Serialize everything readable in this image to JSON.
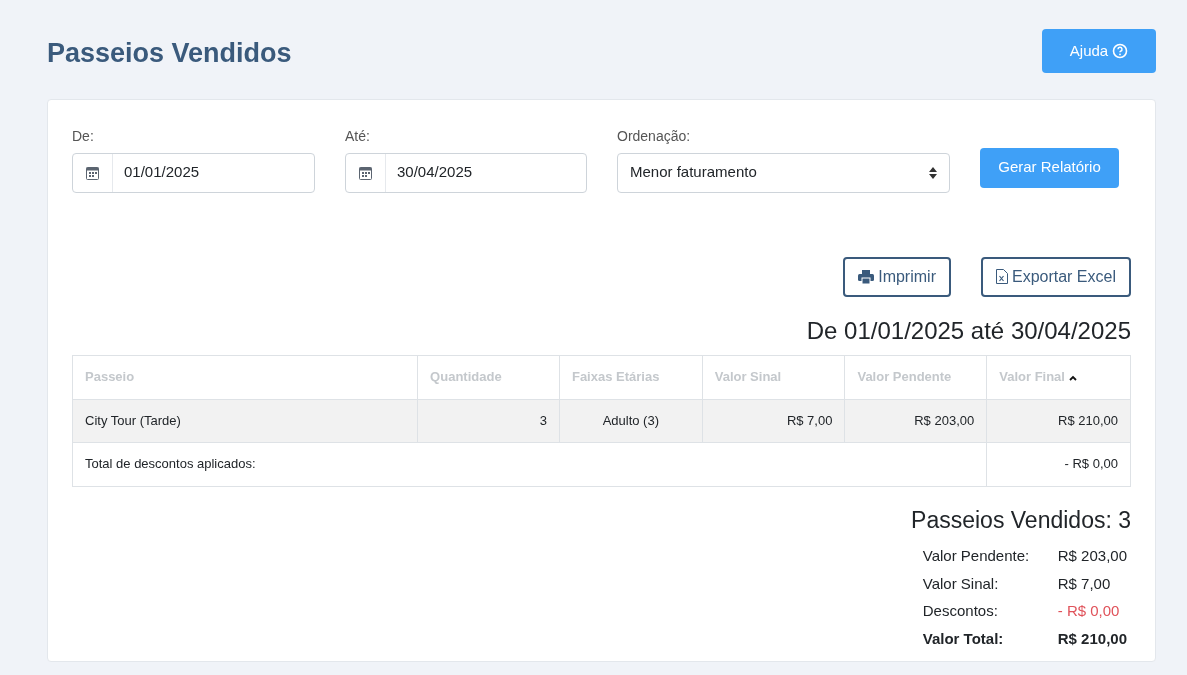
{
  "page": {
    "title": "Passeios Vendidos",
    "help_button": "Ajuda"
  },
  "filters": {
    "from": {
      "label": "De:",
      "value": "01/01/2025"
    },
    "to": {
      "label": "Até:",
      "value": "30/04/2025"
    },
    "sort": {
      "label": "Ordenação:",
      "value": "Menor faturamento"
    },
    "submit": "Gerar Relatório"
  },
  "actions": [
    {
      "kind": "print",
      "label": "Imprimir"
    },
    {
      "kind": "excel",
      "label": "Exportar Excel"
    }
  ],
  "report": {
    "period": "De 01/01/2025 até 30/04/2025",
    "table": {
      "columns": [
        {
          "label": "Passeio",
          "sorted": false
        },
        {
          "label": "Quantidade",
          "sorted": false
        },
        {
          "label": "Faixas Etárias",
          "sorted": false
        },
        {
          "label": "Valor Sinal",
          "sorted": false
        },
        {
          "label": "Valor Pendente",
          "sorted": false
        },
        {
          "label": "Valor Final",
          "sorted": true
        }
      ],
      "rows": [
        [
          "City Tour (Tarde)",
          "3",
          "Adulto (3)",
          "R$ 7,00",
          "R$ 203,00",
          "R$ 210,00"
        ]
      ],
      "discount_row": {
        "label": "Total de descontos aplicados:",
        "value": "- R$ 0,00"
      }
    },
    "summary_title": "Passeios Vendidos: 3",
    "summary": [
      {
        "kind": "normal",
        "label": "Valor Pendente:",
        "value": "R$ 203,00"
      },
      {
        "kind": "normal",
        "label": "Valor Sinal:",
        "value": "R$ 7,00"
      },
      {
        "kind": "negative",
        "label": "Descontos:",
        "value": "- R$ 0,00"
      },
      {
        "kind": "total",
        "label": "Valor Total:",
        "value": "R$ 210,00"
      }
    ]
  }
}
